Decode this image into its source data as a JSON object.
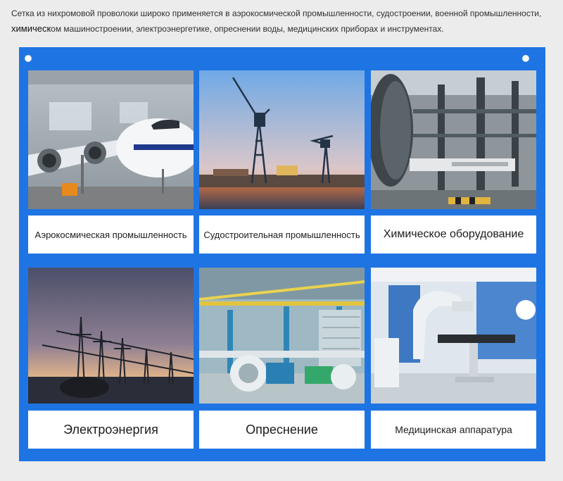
{
  "intro": {
    "line1": "Сетка из нихромовой проволоки широко применяется в аэрокосмической промышленности, судостроении, военной промышленности,",
    "line2_lead": "химическ",
    "line2_rest": "ом машиностроении, электроэнергетике, опреснении воды, медицинских приборах и инструментах."
  },
  "cards": [
    {
      "label": "Аэрокосмическая промышленность",
      "image": "aircraft-hangar-photo"
    },
    {
      "label": "Судостроительная промышленность",
      "image": "shipyard-cranes-photo"
    },
    {
      "label": "Химическое оборудование",
      "image": "chemical-plant-photo"
    },
    {
      "label": "Электроэнергия",
      "image": "power-substation-photo"
    },
    {
      "label": "Опреснение",
      "image": "desalination-plant-photo"
    },
    {
      "label": "Медицинская аппаратура",
      "image": "medical-equipment-photo"
    }
  ],
  "colors": {
    "panel": "#1f74e3",
    "caption_bg": "#ffffff"
  }
}
